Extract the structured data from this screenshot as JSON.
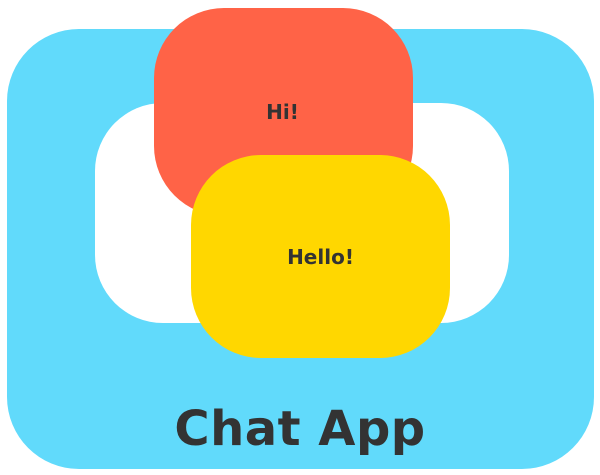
{
  "icon": {
    "title": "Chat App",
    "bubbles": {
      "first": {
        "text": "Hi!",
        "color": "#ff6347"
      },
      "second": {
        "text": "Hello!",
        "color": "#ffd700"
      }
    },
    "colors": {
      "tile": "#61dafb",
      "panel": "#ffffff",
      "text": "#333333"
    }
  }
}
